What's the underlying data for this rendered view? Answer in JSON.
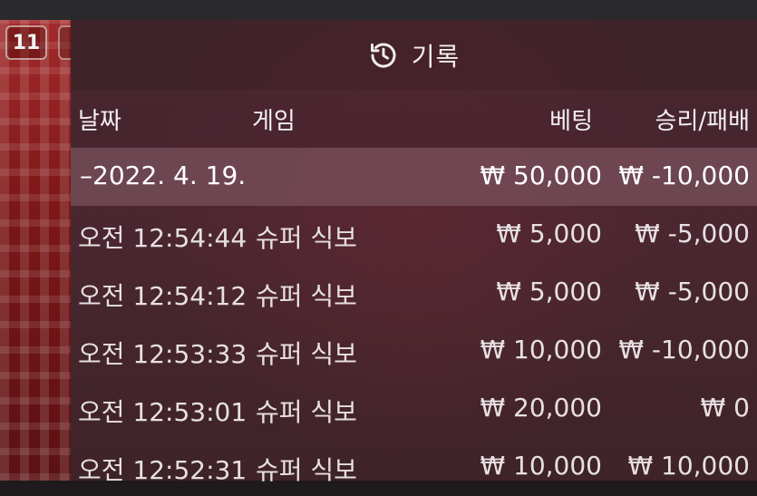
{
  "left_badge": {
    "number": "11"
  },
  "panel": {
    "title": "기록",
    "columns": {
      "date": "날짜",
      "game": "게임",
      "bet": "베팅",
      "win_loss": "승리/패배"
    },
    "group": {
      "date": "–2022. 4. 19.",
      "bet": "₩ 50,000",
      "win_loss": "₩ -10,000"
    },
    "rows": [
      {
        "time": "오전 12:54:44",
        "game": "슈퍼 식보",
        "bet": "₩ 5,000",
        "win_loss": "₩ -5,000"
      },
      {
        "time": "오전 12:54:12",
        "game": "슈퍼 식보",
        "bet": "₩ 5,000",
        "win_loss": "₩ -5,000"
      },
      {
        "time": "오전 12:53:33",
        "game": "슈퍼 식보",
        "bet": "₩ 10,000",
        "win_loss": "₩ -10,000"
      },
      {
        "time": "오전 12:53:01",
        "game": "슈퍼 식보",
        "bet": "₩ 20,000",
        "win_loss": "₩ 0"
      },
      {
        "time": "오전 12:52:31",
        "game": "슈퍼 식보",
        "bet": "₩ 10,000",
        "win_loss": "₩ 10,000"
      }
    ]
  },
  "icons": {
    "history": "history-icon"
  }
}
